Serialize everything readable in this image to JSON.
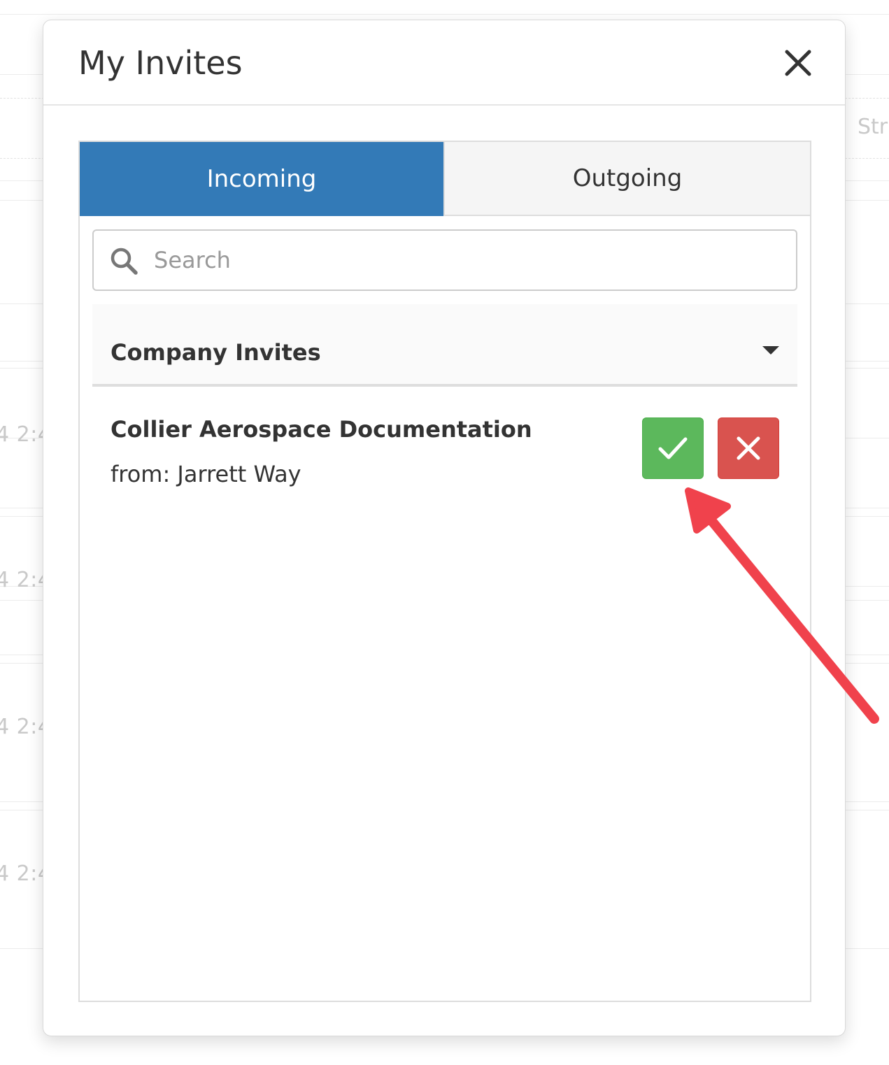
{
  "background": {
    "timestamps": [
      "4 2:4",
      "4 2:4",
      "4 2:4",
      "4 2:4"
    ],
    "column_header_fragment": "Stru"
  },
  "modal": {
    "title": "My Invites",
    "close_icon": "close-icon"
  },
  "tabs": [
    {
      "label": "Incoming",
      "active": true
    },
    {
      "label": "Outgoing",
      "active": false
    }
  ],
  "search": {
    "placeholder": "Search",
    "value": "",
    "icon": "search-icon"
  },
  "section": {
    "title": "Company Invites",
    "icon": "caret-down-icon"
  },
  "invites": [
    {
      "name": "Collier Aerospace Documentation",
      "from": "from: Jarrett Way",
      "accept_icon": "check-icon",
      "decline_icon": "x-icon"
    }
  ],
  "colors": {
    "active_tab": "#337ab7",
    "accept_button": "#5cb85c",
    "decline_button": "#d9534f",
    "annotation_arrow": "#f0424c"
  }
}
